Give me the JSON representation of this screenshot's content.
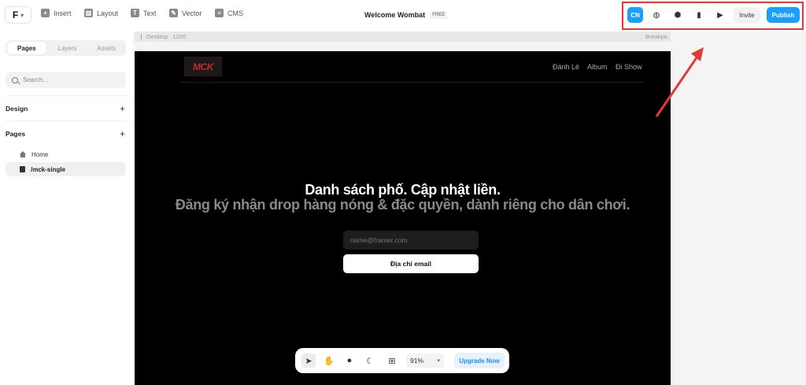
{
  "topbar": {
    "logo": "F",
    "tools": [
      {
        "label": "Insert",
        "icon": "plus-icon"
      },
      {
        "label": "Layout",
        "icon": "layout-icon"
      },
      {
        "label": "Text",
        "icon": "text-icon"
      },
      {
        "label": "Vector",
        "icon": "pen-icon"
      },
      {
        "label": "CMS",
        "icon": "database-icon"
      }
    ],
    "project_title": "Welcome Wombat",
    "plan_badge": "FREE",
    "cn_label": "CN",
    "invite_label": "Invite",
    "publish_label": "Publish",
    "accent_color": "#1a9fff",
    "highlight_color": "#e53935"
  },
  "sidebar": {
    "tabs": [
      {
        "label": "Pages",
        "active": true
      },
      {
        "label": "Layers",
        "active": false
      },
      {
        "label": "Assets",
        "active": false
      }
    ],
    "search_placeholder": "Search...",
    "design_label": "Design",
    "pages_label": "Pages",
    "pages": [
      {
        "label": "Home",
        "icon": "home-icon",
        "selected": false
      },
      {
        "label": "/mck-single",
        "icon": "file-icon",
        "selected": true
      }
    ]
  },
  "canvas": {
    "frame_name": "Desktop",
    "frame_width": "1200",
    "breakpoint_label": "Breakpo",
    "site": {
      "logo_text": "MCK",
      "nav": [
        "Đánh Lẻ",
        "Album",
        "Đi Show"
      ],
      "hero_title": "Danh sách phố. Cập nhật liền.",
      "hero_subtitle": "Đăng ký nhận drop hàng nóng & đặc quyền, dành riêng cho dân chơi.",
      "email_placeholder": "name@framer.com",
      "cta_label": "Địa chỉ email"
    }
  },
  "bottom_toolbar": {
    "tools": [
      "cursor-icon",
      "hand-icon",
      "comment-icon",
      "moon-icon",
      "grid-icon"
    ],
    "zoom": "91%",
    "upgrade_label": "Upgrade Now"
  }
}
